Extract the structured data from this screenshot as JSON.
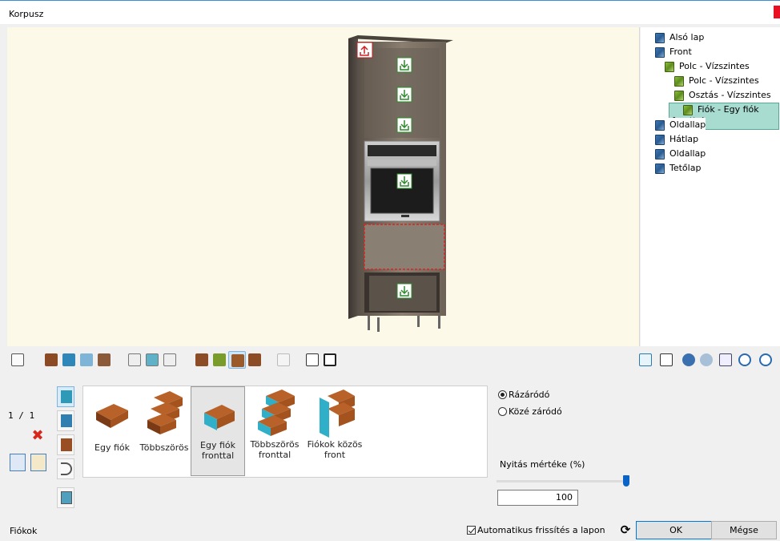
{
  "window": {
    "title": "Korpusz"
  },
  "tree": {
    "items": [
      {
        "label": "Alsó lap",
        "indent": 0,
        "color": "blue"
      },
      {
        "label": "Front",
        "indent": 0,
        "color": "blue"
      },
      {
        "label": "Polc - Vízszintes",
        "indent": 1,
        "color": "green"
      },
      {
        "label": "Polc - Vízszintes",
        "indent": 2,
        "color": "green"
      },
      {
        "label": "Osztás - Vízszintes",
        "indent": 2,
        "color": "green"
      },
      {
        "label": "Fiók - Egy fiók fronttal",
        "indent": 3,
        "color": "green",
        "selected": true
      },
      {
        "label": "Oldallap",
        "indent": 0,
        "color": "blue"
      },
      {
        "label": "Hátlap",
        "indent": 0,
        "color": "blue"
      },
      {
        "label": "Oldallap",
        "indent": 0,
        "color": "blue"
      },
      {
        "label": "Tetőlap",
        "indent": 0,
        "color": "blue"
      }
    ]
  },
  "pager": {
    "text": "1 / 1"
  },
  "gallery": {
    "items": [
      {
        "label": "Egy fiók",
        "selected": false
      },
      {
        "label": "Többszörös",
        "selected": false
      },
      {
        "label": "Egy fiók fronttal",
        "selected": true
      },
      {
        "label": "Többszörös fronttal",
        "selected": false
      },
      {
        "label": "Fiókok közös front",
        "selected": false
      }
    ]
  },
  "options": {
    "radio_1": "Rázáródó",
    "radio_2": "Közé záródó",
    "selected": "Rázáródó",
    "opening_label": "Nyitás mértéke (%)",
    "opening_value": "100",
    "opening_fraction": 1.0
  },
  "status": {
    "label": "Fiókok"
  },
  "footer": {
    "auto_refresh_label": "Automatikus frissítés a lapon",
    "auto_refresh_checked": true,
    "ok_label": "OK",
    "cancel_label": "Mégse"
  },
  "colors": {
    "accent": "#0078d7",
    "viewport_bg": "#fcf9e8",
    "selection": "#a8dcd0",
    "close": "#e81123"
  }
}
